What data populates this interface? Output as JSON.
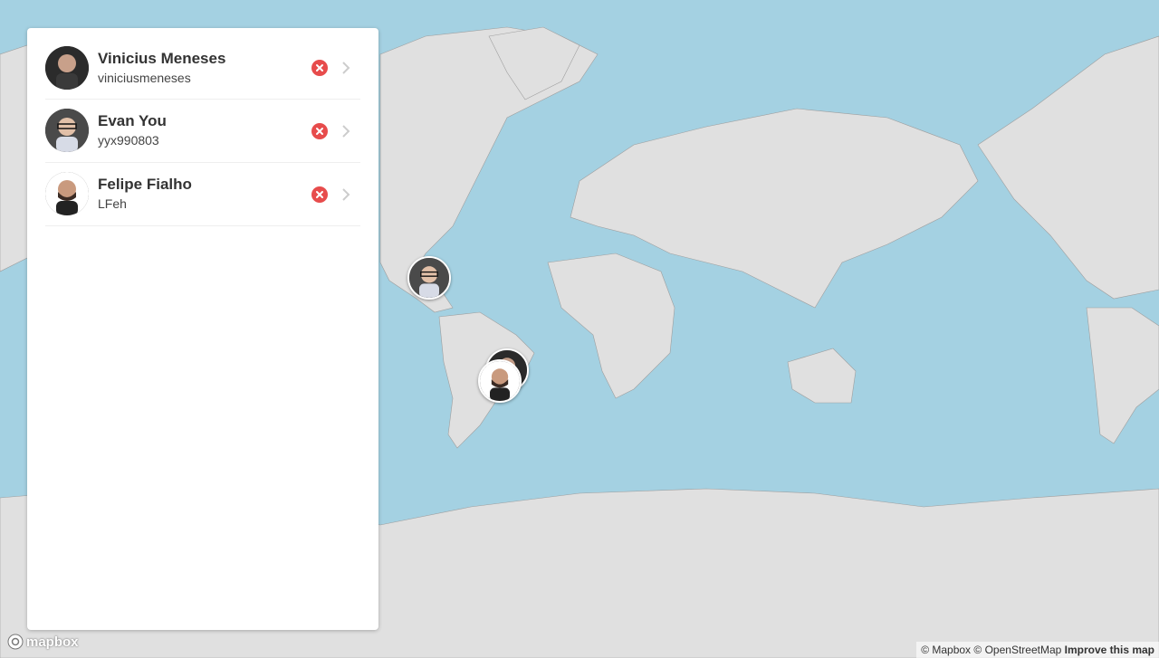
{
  "map": {
    "water_color": "#a4d1e2",
    "land_color": "#e0e0e0",
    "border_color": "#9e9e9e"
  },
  "users": [
    {
      "name": "Vinicius Meneses",
      "login": "viniciusmeneses"
    },
    {
      "name": "Evan You",
      "login": "yyx990803"
    },
    {
      "name": "Felipe Fialho",
      "login": "LFeh"
    }
  ],
  "icons": {
    "remove": "remove-x-circle-icon",
    "chevron": "chevron-right-icon"
  },
  "colors": {
    "remove_red": "#e74c4c",
    "chevron_gray": "#ccc"
  },
  "logo": {
    "text": "mapbox"
  },
  "attribution": {
    "mapbox": "© Mapbox",
    "osm": "© OpenStreetMap",
    "improve": "Improve this map"
  }
}
